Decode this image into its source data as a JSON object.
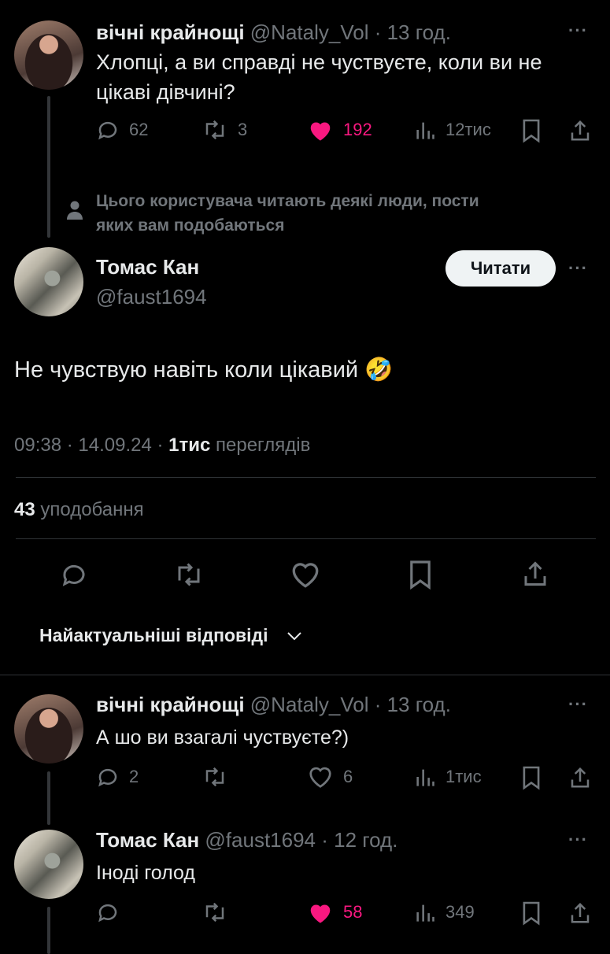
{
  "post1": {
    "name": "вічні крайнощі",
    "handle_time": "@Nataly_Vol · 13 год.",
    "text_line1": "Хлопці, а ви справді не чуствуєте, коли ви не",
    "text_line2": "цікаві дівчині?",
    "replies": "62",
    "reposts": "3",
    "likes": "192",
    "views": "12тис"
  },
  "social_context": {
    "line1": "Цього користувача читають деякі люди, пости",
    "line2": "яких вам подобаються"
  },
  "main_post": {
    "name": "Томас Кан",
    "handle": "@faust1694",
    "follow_label": "Читати",
    "text": "Не чувствую навіть коли цікавий 🤣",
    "timestamp": "09:38 · 14.09.24 · ",
    "views_count": "1тис",
    "views_label": " переглядів",
    "likes_count": "43",
    "likes_label": " уподобання"
  },
  "replies_sort": {
    "label": "Найактуальніші відповіді"
  },
  "reply1": {
    "name": "вічні крайнощі",
    "handle_time": "@Nataly_Vol · 13 год.",
    "text": "А шо ви взагалі чуствуєте?)",
    "replies": "2",
    "likes": "6",
    "views": "1тис"
  },
  "reply2": {
    "name": "Томас Кан",
    "handle_time": "@faust1694 · 12 год.",
    "text": "Іноді голод",
    "likes": "58",
    "views": "349"
  },
  "icons": {
    "more": "···"
  },
  "colors": {
    "like": "#f91880",
    "muted": "#71767b",
    "text": "#e7e9ea",
    "background": "#000000"
  }
}
